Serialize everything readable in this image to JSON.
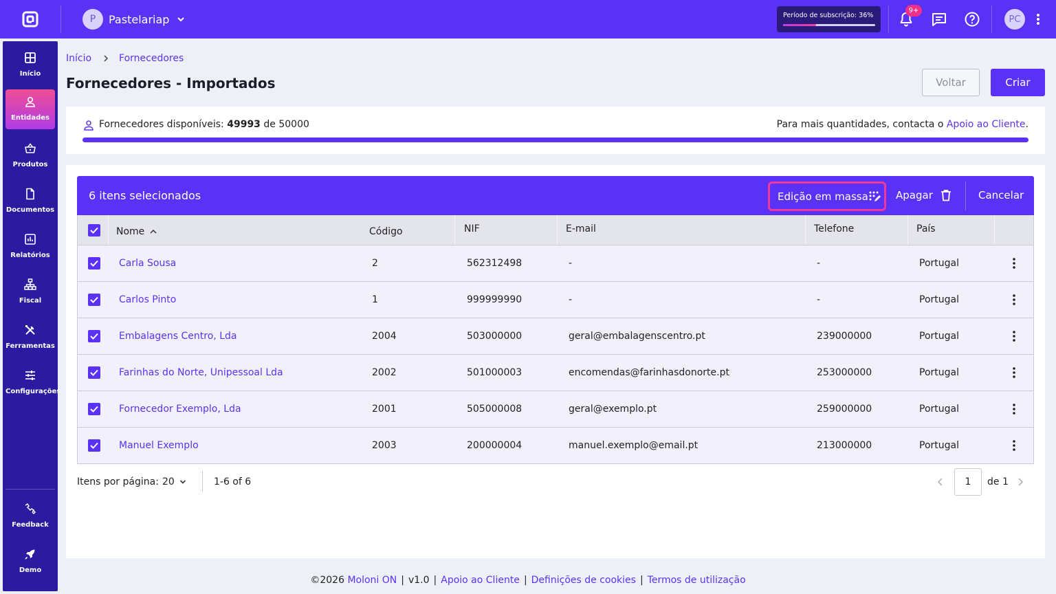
{
  "topbar": {
    "company_initial": "P",
    "company_name": "Pastelariap",
    "subscription_label": "Período de subscrição: 36%",
    "subscription_percent": 36,
    "notifications_badge": "9+",
    "user_initials": "PC",
    "accent": "#5a32f5"
  },
  "sidebar": {
    "items": [
      {
        "label": "Início",
        "icon": "dashboard-icon"
      },
      {
        "label": "Entidades",
        "icon": "user-icon"
      },
      {
        "label": "Produtos",
        "icon": "basket-icon"
      },
      {
        "label": "Documentos",
        "icon": "document-icon"
      },
      {
        "label": "Relatórios",
        "icon": "report-icon"
      },
      {
        "label": "Fiscal",
        "icon": "fiscal-icon"
      },
      {
        "label": "Ferramentas",
        "icon": "tools-icon"
      },
      {
        "label": "Configurações",
        "icon": "sliders-icon"
      }
    ],
    "bottom": [
      {
        "label": "Feedback",
        "icon": "feedback-icon"
      },
      {
        "label": "Demo",
        "icon": "rocket-icon"
      }
    ]
  },
  "breadcrumb": {
    "home": "Início",
    "current": "Fornecedores"
  },
  "page": {
    "title": "Fornecedores - Importados",
    "back_label": "Voltar",
    "create_label": "Criar"
  },
  "quota": {
    "prefix": "Fornecedores disponíveis: ",
    "available": "49993",
    "middle": " de ",
    "total": "50000",
    "right_text": "Para mais quantidades, contacta o ",
    "right_link": "Apoio ao Cliente",
    "right_suffix": ".",
    "fill_fraction": 0.99986
  },
  "selection": {
    "count_label": "6 itens selecionados",
    "bulk_edit_label": "Edição em massa",
    "delete_label": "Apagar",
    "cancel_label": "Cancelar"
  },
  "table": {
    "columns": [
      "Nome",
      "Código",
      "NIF",
      "E-mail",
      "Telefone",
      "País"
    ],
    "rows": [
      {
        "nome": "Carla Sousa",
        "codigo": "2",
        "nif": "562312498",
        "email": "-",
        "telefone": "-",
        "pais": "Portugal"
      },
      {
        "nome": "Carlos Pinto",
        "codigo": "1",
        "nif": "999999990",
        "email": "-",
        "telefone": "-",
        "pais": "Portugal"
      },
      {
        "nome": "Embalagens Centro, Lda",
        "codigo": "2004",
        "nif": "503000000",
        "email": "geral@embalagenscentro.pt",
        "telefone": "239000000",
        "pais": "Portugal"
      },
      {
        "nome": "Farinhas do Norte, Unipessoal Lda",
        "codigo": "2002",
        "nif": "501000003",
        "email": "encomendas@farinhasdonorte.pt",
        "telefone": "253000000",
        "pais": "Portugal"
      },
      {
        "nome": "Fornecedor Exemplo, Lda",
        "codigo": "2001",
        "nif": "505000008",
        "email": "geral@exemplo.pt",
        "telefone": "259000000",
        "pais": "Portugal"
      },
      {
        "nome": "Manuel Exemplo",
        "codigo": "2003",
        "nif": "200000004",
        "email": "manuel.exemplo@email.pt",
        "telefone": "213000000",
        "pais": "Portugal"
      }
    ]
  },
  "pagination": {
    "items_per_page_label": "Itens por página:",
    "items_per_page": "20",
    "range": "1-6 of 6",
    "page": "1",
    "of_label": "de 1"
  },
  "footer": {
    "copyright": "©2026 ",
    "brand": "Moloni ON",
    "version": "v1.0",
    "support": "Apoio ao Cliente",
    "cookies": "Definições de cookies",
    "terms": "Termos de utilização"
  }
}
